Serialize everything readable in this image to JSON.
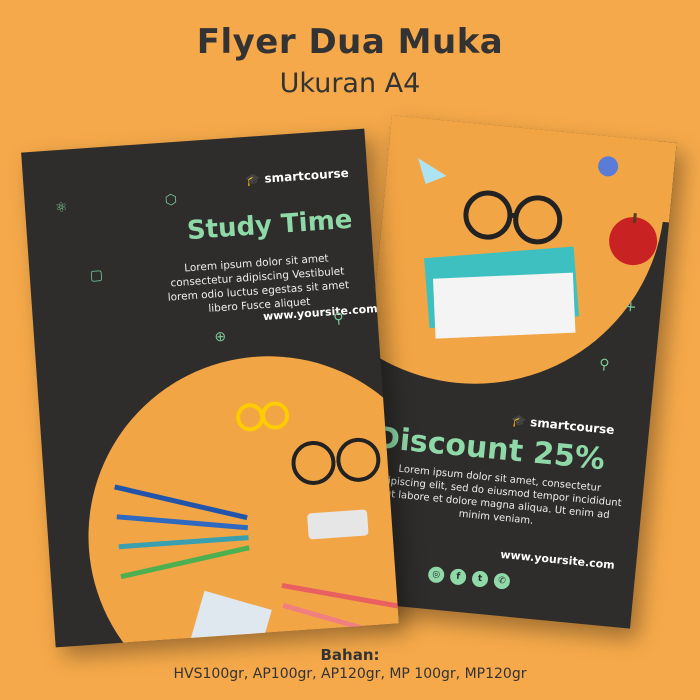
{
  "heading": {
    "title": "Flyer Dua Muka",
    "subtitle": "Ukuran A4"
  },
  "back_flyer": {
    "brand": "smartcourse",
    "headline": "Discount 25%",
    "body": "Lorem ipsum dolor sit amet, consectetur adipiscing elit, sed do eiusmod tempor incididunt ut labore et dolore magna aliqua. Ut enim ad minim veniam.",
    "site": "www.yoursite.com",
    "social_icons": [
      "instagram-icon",
      "facebook-icon",
      "twitter-icon",
      "whatsapp-icon"
    ]
  },
  "front_flyer": {
    "brand": "smartcourse",
    "headline": "Study Time",
    "body": "Lorem ipsum dolor sit amet consectetur adipiscing Vestibulet lorem odio luctus egestas sit amet libero Fusce aliquet",
    "site": "www.yoursite.com"
  },
  "materials": {
    "label": "Bahan:",
    "list": "HVS100gr, AP100gr, AP120gr, MP 100gr, MP120gr"
  },
  "colors": {
    "background": "#f5a94a",
    "flyer": "#2e2d2b",
    "accent": "#8fd9a8"
  }
}
